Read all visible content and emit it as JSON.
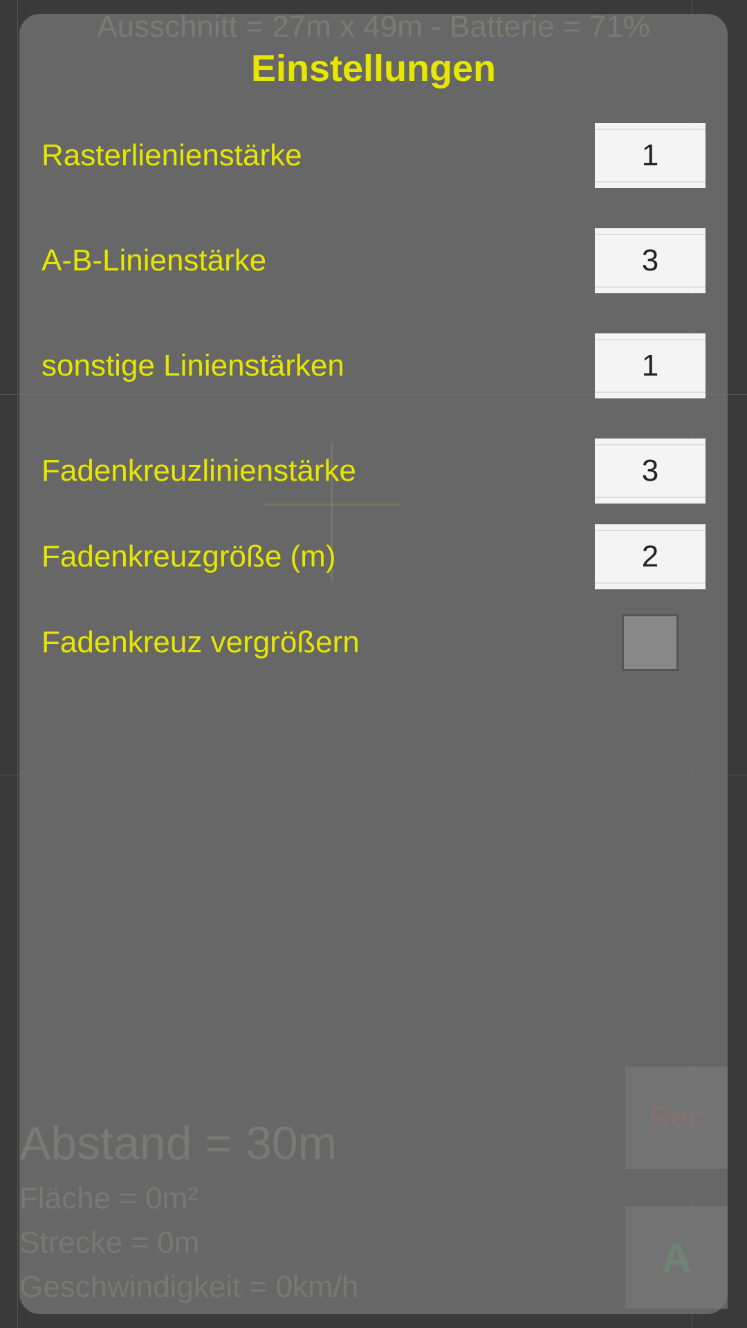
{
  "background": {
    "top_status": "Ausschnitt = 27m x 49m - Batterie = 71%",
    "abstand": "Abstand = 30m",
    "flaeche": "Fläche = 0m²",
    "strecke": "Strecke = 0m",
    "geschwindigkeit": "Geschwindigkeit = 0km/h",
    "rec_label": "Rec",
    "a_label": "A"
  },
  "modal": {
    "title": "Einstellungen",
    "settings": {
      "raster_label": "Rasterlienienstärke",
      "raster_value": "1",
      "ab_label": "A-B-Linienstärke",
      "ab_value": "3",
      "sonstige_label": "sonstige Linienstärken",
      "sonstige_value": "1",
      "fadenkreuz_linie_label": "Fadenkreuzlinienstärke",
      "fadenkreuz_linie_value": "3",
      "fadenkreuz_groesse_label": "Fadenkreuzgröße (m)",
      "fadenkreuz_groesse_value": "2",
      "fadenkreuz_vergroessern_label": "Fadenkreuz vergrößern",
      "fadenkreuz_vergroessern_checked": false
    }
  }
}
